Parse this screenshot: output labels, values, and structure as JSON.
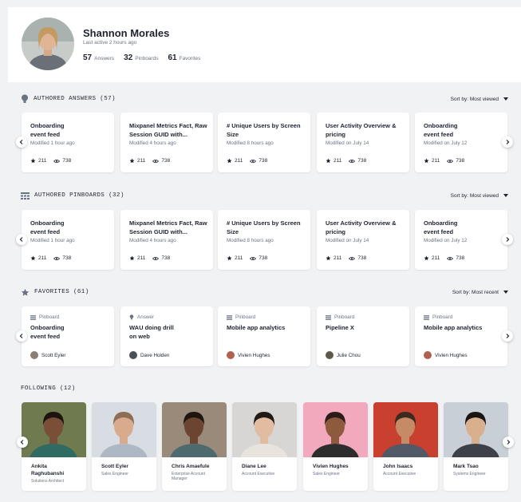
{
  "profile": {
    "name": "Shannon Morales",
    "last_active": "Last active 2 hours ago",
    "stats": [
      {
        "num": "57",
        "label": "Answers"
      },
      {
        "num": "32",
        "label": "Pinboards"
      },
      {
        "num": "61",
        "label": "Favorites"
      }
    ]
  },
  "answers": {
    "title": "AUTHORED ANSWERS (57)",
    "sort": "Sort by: Most viewed",
    "icon": "lightbulb-icon",
    "cards": [
      {
        "title": "Onboarding\nevent feed",
        "modified": "Modified 1 hour ago",
        "stars": "211",
        "views": "738"
      },
      {
        "title": "Mixpanel Metrics Fact, Raw Session GUID with...",
        "modified": "Modified 4 hours ago",
        "stars": "211",
        "views": "738"
      },
      {
        "title": "# Unique Users by Screen Size",
        "modified": "Modified 8 hours ago",
        "stars": "211",
        "views": "738"
      },
      {
        "title": "User Activity Overview & pricing",
        "modified": "Modified on July 14",
        "stars": "211",
        "views": "738"
      },
      {
        "title": "Onboarding\nevent feed",
        "modified": "Modified on July 12",
        "stars": "211",
        "views": "738"
      }
    ]
  },
  "pinboards": {
    "title": "AUTHORED PINBOARDS (32)",
    "sort": "Sort by: Most viewed",
    "icon": "pinboard-icon",
    "cards": [
      {
        "title": "Onboarding\nevent feed",
        "modified": "Modified 1 hour ago",
        "stars": "211",
        "views": "738"
      },
      {
        "title": "Mixpanel Metrics Fact, Raw Session GUID with...",
        "modified": "Modified 4 hours ago",
        "stars": "211",
        "views": "738"
      },
      {
        "title": "# Unique Users by Screen Size",
        "modified": "Modified 8 hours ago",
        "stars": "211",
        "views": "738"
      },
      {
        "title": "User Activity Overview & pricing",
        "modified": "Modified on July 14",
        "stars": "211",
        "views": "738"
      },
      {
        "title": "Onboarding\nevent feed",
        "modified": "Modified on July 12",
        "stars": "211",
        "views": "738"
      }
    ]
  },
  "favorites": {
    "title": "FAVORITES (61)",
    "sort": "Sort by: Most recent",
    "icon": "star-icon",
    "cards": [
      {
        "type": "Pinboard",
        "title": "Onboarding\nevent feed",
        "user": "Scott Eyler",
        "avatar_color": "#8b7f74"
      },
      {
        "type": "Answer",
        "title": "WAU doing drill\non web",
        "user": "Dave Holden",
        "avatar_color": "#4a4f58"
      },
      {
        "type": "Pinboard",
        "title": "Mobile app analytics",
        "user": "Vivien Hughes",
        "avatar_color": "#b0624f"
      },
      {
        "type": "Pinboard",
        "title": "Pipeline X",
        "user": "Julie Chou",
        "avatar_color": "#5e5a4a"
      },
      {
        "type": "Pinboard",
        "title": "Mobile app analytics",
        "user": "Vivien Hughes",
        "avatar_color": "#b0624f"
      }
    ]
  },
  "following": {
    "title": "FOLLOWING (12)",
    "people": [
      {
        "name": "Ankita\nRaghubanshi",
        "role": "Solutions Architect",
        "bg": "#6f7a4e",
        "skin": "#7a4f37",
        "hair": "#1c140f",
        "shirt": "#2f6b63"
      },
      {
        "name": "Scott Eyler",
        "role": "Sales Engineer",
        "bg": "#d7dde2",
        "skin": "#d9ab8c",
        "hair": "#8c6e53",
        "shirt": "#aeb8c4"
      },
      {
        "name": "Chris Amaefule",
        "role": "Enterprise Account\nManager",
        "bg": "#9a8a7a",
        "skin": "#6b452f",
        "hair": "#1e1510",
        "shirt": "#4d6b6e"
      },
      {
        "name": "Diane Lee",
        "role": "Account Executive",
        "bg": "#d8d6d4",
        "skin": "#e2bca0",
        "hair": "#231a16",
        "shirt": "#e8e3dc"
      },
      {
        "name": "Vivien Hughes",
        "role": "Sales Engineer",
        "bg": "#f2a8bd",
        "skin": "#8e5a3e",
        "hair": "#2a1d18",
        "shirt": "#2d2d2d"
      },
      {
        "name": "John Isaacs",
        "role": "Account Executive",
        "bg": "#c9402f",
        "skin": "#c48b66",
        "hair": "#3a2a1f",
        "shirt": "#515a66"
      },
      {
        "name": "Mark Tsao",
        "role": "Systems Engineer",
        "bg": "#c9cfd6",
        "skin": "#d8b08d",
        "hair": "#191512",
        "shirt": "#3e4248"
      }
    ]
  }
}
